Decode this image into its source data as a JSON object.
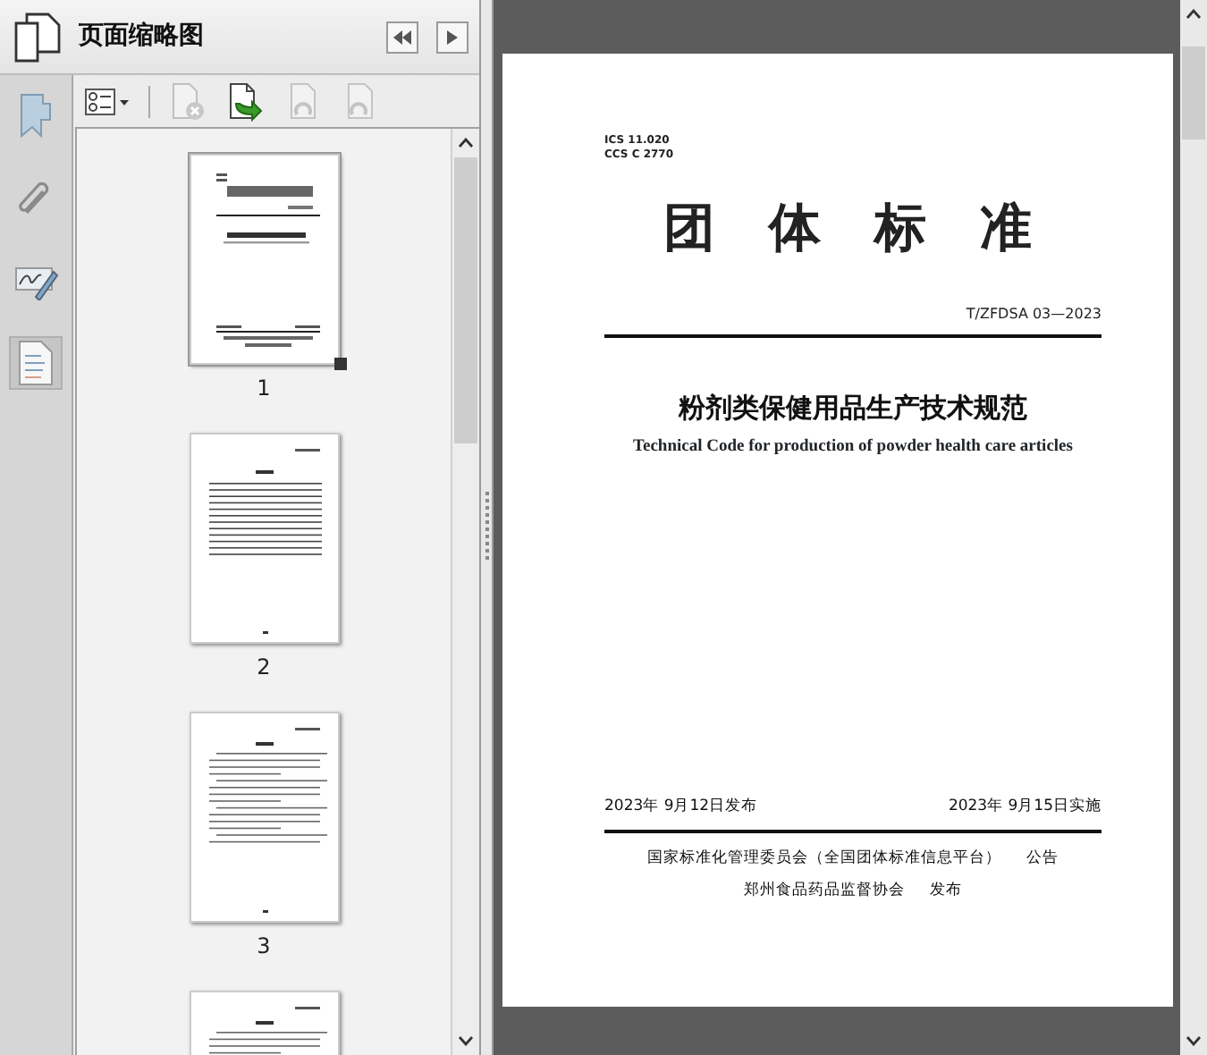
{
  "panel": {
    "title": "页面缩略图"
  },
  "toolbar": [
    {
      "kind": "options",
      "disabled": false
    },
    {
      "kind": "delete",
      "disabled": true
    },
    {
      "kind": "insert",
      "disabled": false
    },
    {
      "kind": "rotate-left",
      "disabled": true
    },
    {
      "kind": "rotate-right",
      "disabled": true
    }
  ],
  "rail": [
    {
      "kind": "bookmark",
      "selected": false
    },
    {
      "kind": "attachment",
      "selected": false
    },
    {
      "kind": "signature",
      "selected": false
    },
    {
      "kind": "pages",
      "selected": true
    }
  ],
  "thumbnails": [
    {
      "kind": "cover",
      "label": "1",
      "selected": true
    },
    {
      "kind": "contents",
      "label": "2",
      "selected": false
    },
    {
      "kind": "text",
      "label": "3",
      "selected": false
    },
    {
      "kind": "text",
      "selected": false
    }
  ],
  "document": {
    "codes": [
      "ICS 11.020",
      "CCS C 2770"
    ],
    "heading": "团 体 标 准",
    "number": "T/ZFDSA 03—2023",
    "title": "粉剂类保健用品生产技术规范",
    "subtitle": "Technical Code for production of powder health care articles",
    "issue_date": "2023年 9月12日发布",
    "effective_date": "2023年 9月15日实施",
    "publishers": [
      {
        "name": "国家标准化管理委员会（全国团体标准信息平台）",
        "action": "公告"
      },
      {
        "name": "郑州食品药品监督协会",
        "action": "发布"
      }
    ]
  }
}
